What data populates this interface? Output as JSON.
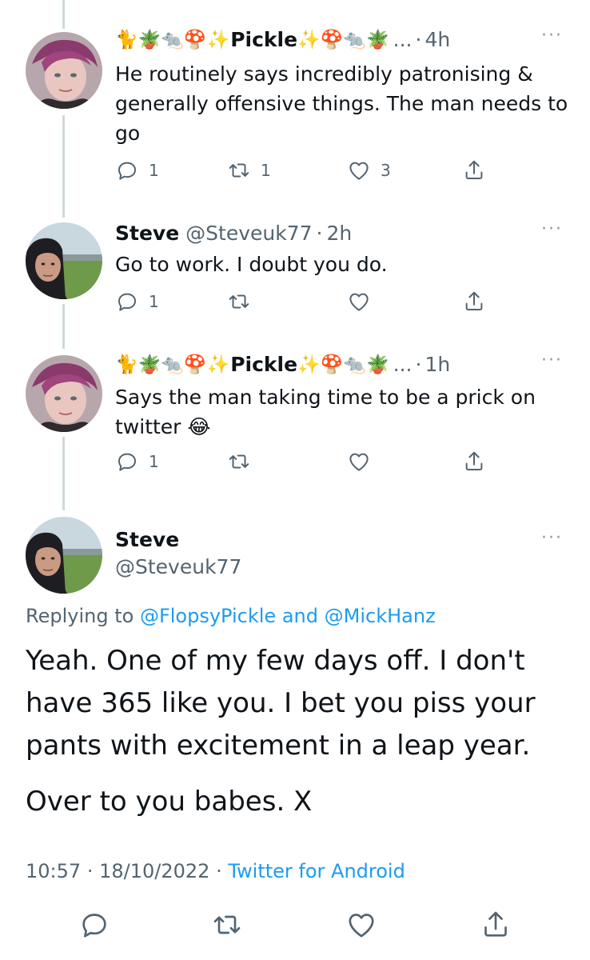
{
  "replies": [
    {
      "name_prefix": "🐈🪴🐀🍄✨",
      "name": "Pickle",
      "name_suffix": "✨🍄🐀🪴",
      "ellipsis": "...",
      "sep": "·",
      "time": "4h",
      "more": "···",
      "text": "He routinely says incredibly patronising & generally offensive things. The man needs to go",
      "reply_count": "1",
      "retweet_count": "1",
      "like_count": "3"
    },
    {
      "name": "Steve",
      "handle": "@Steveuk77",
      "sep": "·",
      "time": "2h",
      "more": "···",
      "text": "Go to work. I doubt you do.",
      "reply_count": "1",
      "retweet_count": "",
      "like_count": ""
    },
    {
      "name_prefix": "🐈🪴🐀🍄✨",
      "name": "Pickle",
      "name_suffix": "✨🍄🐀🪴",
      "ellipsis": "...",
      "sep": "·",
      "time": "1h",
      "more": "···",
      "text_line1": "Says the man taking time to be a prick on",
      "text_line2": "twitter 😂",
      "reply_count": "1",
      "retweet_count": "",
      "like_count": ""
    }
  ],
  "main": {
    "name": "Steve",
    "handle": "@Steveuk77",
    "more": "···",
    "replying_prefix": "Replying to",
    "replying_user1": "@FlopsyPickle",
    "replying_and": "and",
    "replying_user2": "@MickHanz",
    "text_lines": [
      "Yeah. One of my few days off. I don't",
      "have 365 like you. I bet you piss your",
      "pants with excitement in a  leap year."
    ],
    "text_tail": "Over to you babes. X",
    "time": "10:57",
    "sep": "·",
    "date": "18/10/2022",
    "source": "Twitter for Android"
  },
  "colors": {
    "text": "#0f1419",
    "secondary": "#536471",
    "link": "#1d9bf0",
    "thread_line": "#cfd9de"
  },
  "icons": [
    "reply-icon",
    "retweet-icon",
    "like-icon",
    "share-icon",
    "more-icon"
  ]
}
